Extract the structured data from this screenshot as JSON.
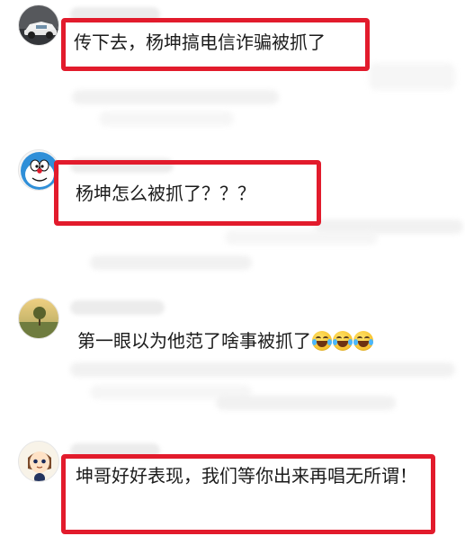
{
  "comments": [
    {
      "text": "传下去，杨坤搞电信诈骗被抓了"
    },
    {
      "text": "杨坤怎么被抓了？？？"
    },
    {
      "text": "第一眼以为他范了啥事被抓了",
      "emoji_count": 3,
      "emoji_name": "laugh-cry-emoji"
    },
    {
      "text": "坤哥好好表现，我们等你出来再唱无所谓！"
    }
  ],
  "colors": {
    "highlight": "#e21b2c",
    "text": "#1b1b1b",
    "background": "#ffffff"
  }
}
